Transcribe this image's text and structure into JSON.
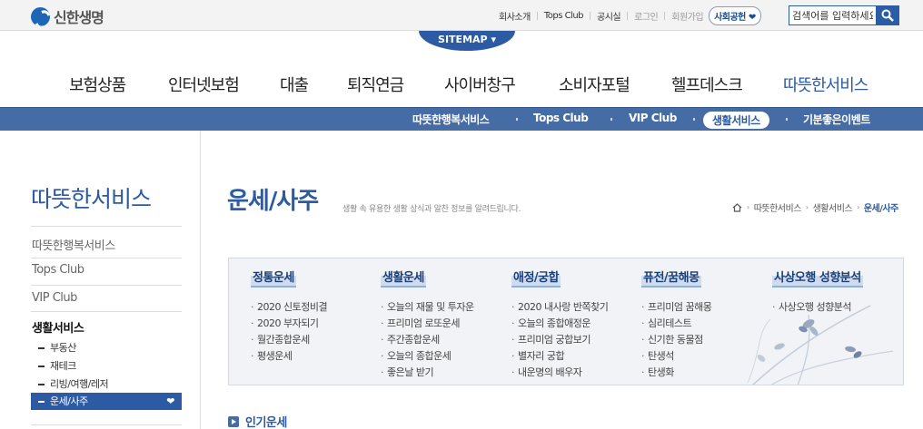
{
  "header": {
    "logo_text": "신한생명",
    "util_links": [
      {
        "label": "회사소개"
      },
      {
        "label": "Tops Club"
      },
      {
        "label": "공시실"
      },
      {
        "label": "로그인"
      },
      {
        "label": "회원가입"
      }
    ],
    "social_label": "사회공헌",
    "search_placeholder": "검색어를 입력하세요",
    "sitemap_label": "SITEMAP"
  },
  "gnb": [
    {
      "label": "보험상품"
    },
    {
      "label": "인터넷보험"
    },
    {
      "label": "대출"
    },
    {
      "label": "퇴직연금"
    },
    {
      "label": "사이버창구"
    },
    {
      "label": "소비자포털"
    },
    {
      "label": "헬프데스크"
    },
    {
      "label": "따뜻한서비스"
    }
  ],
  "subnav": [
    {
      "label": "따뜻한행복서비스"
    },
    {
      "label": "Tops Club"
    },
    {
      "label": "VIP Club"
    },
    {
      "label": "생활서비스"
    },
    {
      "label": "기분좋은이벤트"
    }
  ],
  "lnb": {
    "title": "따뜻한서비스",
    "items": [
      {
        "label": "따뜻한행복서비스"
      },
      {
        "label": "Tops Club"
      },
      {
        "label": "VIP Club"
      },
      {
        "label": "생활서비스"
      }
    ],
    "sub_items": [
      {
        "label": "부동산"
      },
      {
        "label": "재테크"
      },
      {
        "label": "리빙/여행/레저"
      },
      {
        "label": "운세/사주"
      }
    ]
  },
  "content": {
    "title": "운세/사주",
    "description": "생활 속 유용한 생활 상식과 알찬 정보를 알려드립니다.",
    "breadcrumb": [
      {
        "label": "따뜻한서비스"
      },
      {
        "label": "생활서비스"
      },
      {
        "label": "운세/사주"
      }
    ],
    "categories": [
      {
        "title": "정통운세",
        "items": [
          "2020 신토정비결",
          "2020 부자되기",
          "월간종합운세",
          "평생운세"
        ]
      },
      {
        "title": "생활운세",
        "items": [
          "오늘의 재물 및 투자운",
          "프리미엄 로또운세",
          "주간종합운세",
          "오늘의 종합운세",
          "좋은날 받기"
        ]
      },
      {
        "title": "애정/궁합",
        "items": [
          "2020 내사랑 반쪽찾기",
          "오늘의 종합애정운",
          "프리미엄 궁합보기",
          "별자리 궁합",
          "내운명의 배우자"
        ]
      },
      {
        "title": "퓨전/꿈해몽",
        "items": [
          "프리미엄 꿈해몽",
          "심리테스트",
          "신기한 동물점",
          "탄생석",
          "탄생화"
        ]
      },
      {
        "title": "사상오행 성향분석",
        "items": [
          "사상오행 성향분석"
        ]
      }
    ],
    "popular_label": "인기운세"
  },
  "colors": {
    "brand_blue": "#2c5ba3",
    "subnav_bg": "#466ca6",
    "box_bg": "#f1f3f6"
  }
}
